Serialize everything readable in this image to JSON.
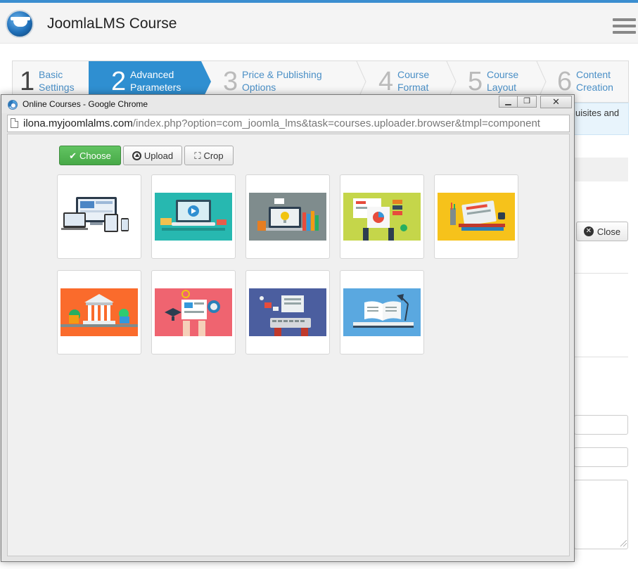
{
  "app": {
    "title": "JoomlaLMS Course"
  },
  "steps": [
    {
      "number": "1",
      "label": "Basic\nSettings",
      "state": "done"
    },
    {
      "number": "2",
      "label": "Advanced\nParameters",
      "state": "active"
    },
    {
      "number": "3",
      "label": "Price & Publishing\nOptions",
      "state": "pending"
    },
    {
      "number": "4",
      "label": "Course\nFormat",
      "state": "pending"
    },
    {
      "number": "5",
      "label": "Course\nLayout",
      "state": "pending"
    },
    {
      "number": "6",
      "label": "Content\nCreation",
      "state": "pending"
    }
  ],
  "background": {
    "info_text_fragment": "uisites and",
    "close_label": "Close"
  },
  "popup": {
    "window_title": "Online Courses - Google Chrome",
    "url_host": "ilona.myjoomlalms.com",
    "url_path": "/index.php?option=com_joomla_lms&task=courses.uploader.browser&tmpl=component",
    "buttons": {
      "choose": "Choose",
      "upload": "Upload",
      "crop": "Crop"
    },
    "images": [
      {
        "icon": "responsive-devices-image",
        "bg": "#ffffff"
      },
      {
        "icon": "laptop-video-course-image",
        "bg": "#27b8b0"
      },
      {
        "icon": "computer-idea-books-image",
        "bg": "#7f8c8d"
      },
      {
        "icon": "analytics-presentation-image",
        "bg": "#c5d64a"
      },
      {
        "icon": "study-desk-books-image",
        "bg": "#f6c21b"
      },
      {
        "icon": "university-building-image",
        "bg": "#fa6b2c"
      },
      {
        "icon": "graduation-research-image",
        "bg": "#ef6470"
      },
      {
        "icon": "online-learning-keyboard-image",
        "bg": "#4b5e9f"
      },
      {
        "icon": "open-book-lamp-image",
        "bg": "#5aa8e0"
      }
    ]
  }
}
